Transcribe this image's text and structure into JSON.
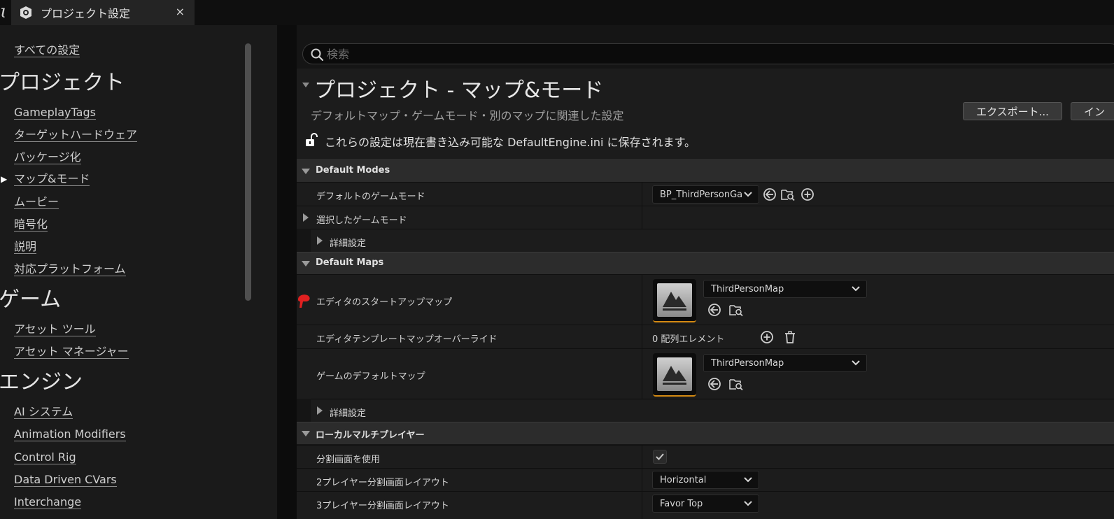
{
  "tab": {
    "title": "プロジェクト設定",
    "close": "×"
  },
  "sidebar": {
    "all_settings": "すべての設定",
    "sections": [
      {
        "title": "プロジェクト",
        "items": [
          "GameplayTags",
          "ターゲットハードウェア",
          "パッケージ化",
          "マップ&モード",
          "ムービー",
          "暗号化",
          "説明",
          "対応プラットフォーム"
        ]
      },
      {
        "title": "ゲーム",
        "items": [
          "アセット ツール",
          "アセット マネージャー"
        ]
      },
      {
        "title": "エンジン",
        "items": [
          "AI システム",
          "Animation Modifiers",
          "Control Rig",
          "Data Driven CVars",
          "Interchange"
        ]
      }
    ],
    "selected_marker": "▶"
  },
  "search": {
    "placeholder": "検索"
  },
  "header": {
    "title": "プロジェクト - マップ&モード",
    "subtitle": "デフォルトマップ・ゲームモード・別のマップに関連した設定",
    "export_button": "エクスポート...",
    "import_button": "イン",
    "save_note": "これらの設定は現在書き込み可能な DefaultEngine.ini に保存されます。"
  },
  "default_modes": {
    "title": "Default Modes",
    "default_game_mode": {
      "label": "デフォルトのゲームモード",
      "value": "BP_ThirdPersonGar"
    },
    "selected_game_mode": {
      "label": "選択したゲームモード"
    },
    "advanced": {
      "label": "詳細設定"
    }
  },
  "default_maps": {
    "title": "Default Maps",
    "editor_startup_map": {
      "label": "エディタのスタートアップマップ",
      "value": "ThirdPersonMap"
    },
    "template_override": {
      "label": "エディタテンプレートマップオーバーライド",
      "count": "0 配列エレメント"
    },
    "game_default_map": {
      "label": "ゲームのデフォルトマップ",
      "value": "ThirdPersonMap"
    },
    "advanced": {
      "label": "詳細設定"
    }
  },
  "local_multiplayer": {
    "title": "ローカルマルチプレイヤー",
    "use_splitscreen": {
      "label": "分割画面を使用",
      "checked": true
    },
    "two_player_layout": {
      "label": "2プレイヤー分割画面レイアウト",
      "value": "Horizontal"
    },
    "three_player_layout": {
      "label": "3プレイヤー分割画面レイアウト",
      "value": "Favor Top"
    }
  },
  "icons": [
    "unreal-logo-icon",
    "settings-gear-icon",
    "close-icon",
    "search-icon",
    "unlock-icon",
    "browse-to-asset-icon",
    "find-in-browser-icon",
    "add-icon",
    "trash-icon",
    "chevron-down-icon",
    "checkmark-icon",
    "map-thumbnail-icon",
    "pin-marker-icon"
  ],
  "colors": {
    "accent_orange": "#d48a12",
    "pin_red": "#e02020",
    "panel": "#1c1c1c",
    "category": "#2c2c2c"
  }
}
